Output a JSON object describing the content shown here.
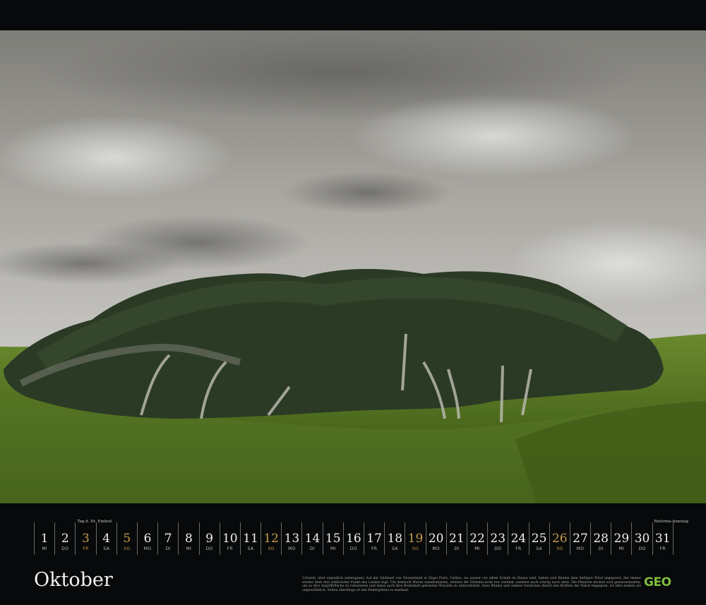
{
  "month": "Oktober",
  "logo": "GEO",
  "caption": "Cobweb, aber eigentlich unbeugsam: Auf der Südinsel von Neuseeland in Slope Point, Catlins, wo ausser vor allem Schafe zu Hause sind, haben sich Bäume dem heftigen Wind angepasst, der immer wieder über den südlichsten Punkt des Landes fegt. Um dennoch Wuchs standzuhalten, streben die Stämme nicht nur vertikal, sondern auch schräg nach oben. Die Pflanzen ducken sich gewissermaßen, um so ihre Angriffsfläche zu reduzieren und dabei auch ihre Bodenhalt gebenden Wurzeln zu unterstützen. Dass Bäume und andere Gewächse derart den Kräften der Natur begegnen, ist alles andere als ungewöhnlich. Selten allerdings ist das Endergebnis so markant",
  "accent_color": "#c39a4e",
  "days": [
    {
      "n": "1",
      "wd": "MI"
    },
    {
      "n": "2",
      "wd": "DO"
    },
    {
      "n": "3",
      "wd": "FR",
      "holiday": true,
      "note": "Tag d. Dt. Einheit"
    },
    {
      "n": "4",
      "wd": "SA"
    },
    {
      "n": "5",
      "wd": "SO",
      "holiday": true
    },
    {
      "n": "6",
      "wd": "MO"
    },
    {
      "n": "7",
      "wd": "DI"
    },
    {
      "n": "8",
      "wd": "MI"
    },
    {
      "n": "9",
      "wd": "DO"
    },
    {
      "n": "10",
      "wd": "FR"
    },
    {
      "n": "11",
      "wd": "SA"
    },
    {
      "n": "12",
      "wd": "SO",
      "holiday": true
    },
    {
      "n": "13",
      "wd": "MO"
    },
    {
      "n": "14",
      "wd": "DI"
    },
    {
      "n": "15",
      "wd": "MI"
    },
    {
      "n": "16",
      "wd": "DO"
    },
    {
      "n": "17",
      "wd": "FR"
    },
    {
      "n": "18",
      "wd": "SA"
    },
    {
      "n": "19",
      "wd": "SO",
      "holiday": true
    },
    {
      "n": "20",
      "wd": "MO"
    },
    {
      "n": "21",
      "wd": "DI"
    },
    {
      "n": "22",
      "wd": "MI"
    },
    {
      "n": "23",
      "wd": "DO"
    },
    {
      "n": "24",
      "wd": "FR"
    },
    {
      "n": "25",
      "wd": "SA"
    },
    {
      "n": "26",
      "wd": "SO",
      "holiday": true
    },
    {
      "n": "27",
      "wd": "MO"
    },
    {
      "n": "28",
      "wd": "DI"
    },
    {
      "n": "29",
      "wd": "MI"
    },
    {
      "n": "30",
      "wd": "DO"
    },
    {
      "n": "31",
      "wd": "FR",
      "note": "Reforma-tionstag"
    }
  ]
}
